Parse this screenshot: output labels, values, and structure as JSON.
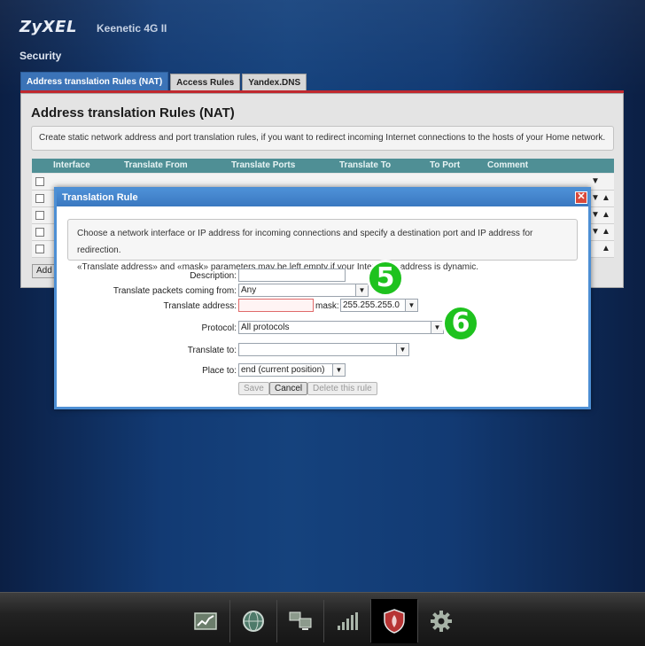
{
  "header": {
    "brand": "ZyXEL",
    "model": "Keenetic 4G II",
    "section": "Security"
  },
  "tabs": [
    {
      "label": "Address translation Rules (NAT)"
    },
    {
      "label": "Access Rules"
    },
    {
      "label": "Yandex.DNS"
    }
  ],
  "panel": {
    "title": "Address translation Rules (NAT)",
    "description": "Create static network address and port translation rules, if you want to redirect incoming Internet connections to the hosts of your Home network.",
    "columns": [
      "Interface",
      "Translate From",
      "Translate Ports",
      "Translate To",
      "To Port",
      "Comment"
    ],
    "add_label": "Add"
  },
  "modal": {
    "title": "Translation Rule",
    "close_label": "✕",
    "info_line1": "Choose a network interface or IP address for incoming connections and specify a destination port and IP address for redirection.",
    "info_line2": "«Translate address» and «mask» parameters may be left empty if your Internet IP address is dynamic.",
    "fields": {
      "description_label": "Description:",
      "description_value": "",
      "coming_from_label": "Translate packets coming from:",
      "coming_from_value": "Any",
      "translate_address_label": "Translate address:",
      "translate_address_value": "",
      "mask_label": "mask:",
      "mask_value": "255.255.255.0",
      "protocol_label": "Protocol:",
      "protocol_value": "All protocols",
      "translate_to_label": "Translate to:",
      "translate_to_value": "",
      "place_to_label": "Place to:",
      "place_to_value": "end (current position)"
    },
    "buttons": {
      "save": "Save",
      "cancel": "Cancel",
      "delete": "Delete this rule"
    }
  },
  "annotations": {
    "step5": "5",
    "step6": "6"
  },
  "bottom_nav": [
    {
      "icon": "chart-icon"
    },
    {
      "icon": "globe-icon"
    },
    {
      "icon": "network-icon"
    },
    {
      "icon": "signal-icon"
    },
    {
      "icon": "shield-icon",
      "active": true
    },
    {
      "icon": "gear-icon"
    }
  ],
  "colors": {
    "accent": "#3b73b7",
    "badge": "#1ec21e",
    "tab_underline": "#c0282e"
  }
}
